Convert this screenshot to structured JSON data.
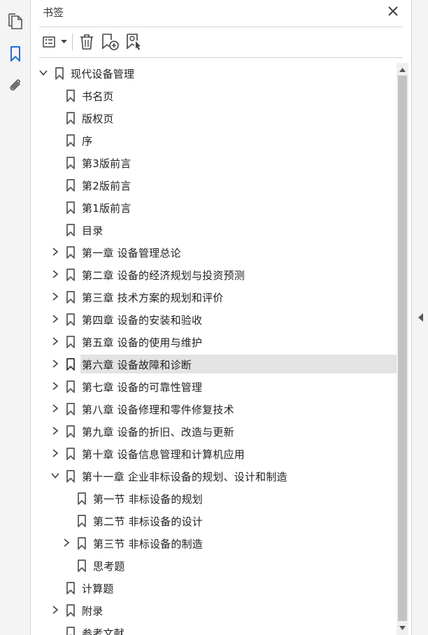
{
  "panel": {
    "title": "书签"
  },
  "toolbar": {
    "options": "options-menu",
    "delete": "delete-bookmark",
    "new": "new-bookmark",
    "new_from_structure": "new-bookmark-from-structure"
  },
  "colors": {
    "accent": "#1473e6",
    "selected_bg": "#e3e3e3",
    "icon": "#555555"
  },
  "bookmarks": [
    {
      "label": "现代设备管理",
      "level": 0,
      "expander": "expanded"
    },
    {
      "label": "书名页",
      "level": 1,
      "expander": "none"
    },
    {
      "label": "版权页",
      "level": 1,
      "expander": "none"
    },
    {
      "label": "序",
      "level": 1,
      "expander": "none"
    },
    {
      "label": "第3版前言",
      "level": 1,
      "expander": "none"
    },
    {
      "label": "第2版前言",
      "level": 1,
      "expander": "none"
    },
    {
      "label": "第1版前言",
      "level": 1,
      "expander": "none"
    },
    {
      "label": "目录",
      "level": 1,
      "expander": "none"
    },
    {
      "label": "第一章  设备管理总论",
      "level": 1,
      "expander": "collapsed"
    },
    {
      "label": "第二章  设备的经济规划与投资预测",
      "level": 1,
      "expander": "collapsed"
    },
    {
      "label": "第三章  技术方案的规划和评价",
      "level": 1,
      "expander": "collapsed"
    },
    {
      "label": "第四章  设备的安装和验收",
      "level": 1,
      "expander": "collapsed"
    },
    {
      "label": "第五章  设备的使用与维护",
      "level": 1,
      "expander": "collapsed"
    },
    {
      "label": "第六章  设备故障和诊断",
      "level": 1,
      "expander": "collapsed",
      "selected": true
    },
    {
      "label": "第七章  设备的可靠性管理",
      "level": 1,
      "expander": "collapsed"
    },
    {
      "label": "第八章  设备修理和零件修复技术",
      "level": 1,
      "expander": "collapsed"
    },
    {
      "label": "第九章  设备的折旧、改造与更新",
      "level": 1,
      "expander": "collapsed"
    },
    {
      "label": "第十章  设备信息管理和计算机应用",
      "level": 1,
      "expander": "collapsed"
    },
    {
      "label": "第十一章  企业非标设备的规划、设计和制造",
      "level": 1,
      "expander": "expanded"
    },
    {
      "label": "第一节  非标设备的规划",
      "level": 2,
      "expander": "none"
    },
    {
      "label": "第二节  非标设备的设计",
      "level": 2,
      "expander": "none"
    },
    {
      "label": "第三节  非标设备的制造",
      "level": 2,
      "expander": "collapsed"
    },
    {
      "label": "思考题",
      "level": 2,
      "expander": "none"
    },
    {
      "label": "计算题",
      "level": 1,
      "expander": "none"
    },
    {
      "label": "附录",
      "level": 1,
      "expander": "collapsed"
    },
    {
      "label": "参考文献",
      "level": 1,
      "expander": "none"
    }
  ]
}
